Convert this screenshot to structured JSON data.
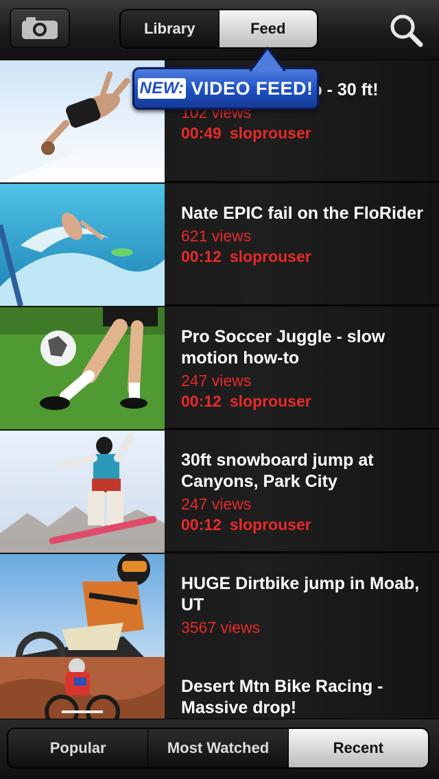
{
  "header": {
    "camera_icon": "camera-icon",
    "segments": [
      {
        "label": "Library",
        "selected": false
      },
      {
        "label": "Feed",
        "selected": true
      }
    ],
    "search_icon": "search-icon"
  },
  "callout": {
    "badge": "NEW:",
    "text": "VIDEO FEED!"
  },
  "feed": {
    "items": [
      {
        "title": "HUGE Bike Jump - 30 ft!",
        "views": "102 views",
        "duration": "00:49",
        "user": "sloprouser"
      },
      {
        "title": "Nate EPIC fail on the FloRider",
        "views": "621 views",
        "duration": "00:12",
        "user": "sloprouser"
      },
      {
        "title": "Pro Soccer Juggle - slow motion how-to",
        "views": "247 views",
        "duration": "00:12",
        "user": "sloprouser"
      },
      {
        "title": "30ft snowboard jump at Canyons, Park City",
        "views": "247 views",
        "duration": "00:12",
        "user": "sloprouser"
      },
      {
        "title": "HUGE Dirtbike jump in Moab, UT",
        "views": "3567 views",
        "duration": "",
        "user": ""
      },
      {
        "title": "Desert Mtn Bike Racing - Massive drop!",
        "views": "",
        "duration": "",
        "user": ""
      }
    ]
  },
  "footer": {
    "tabs": [
      {
        "label": "Popular",
        "selected": false
      },
      {
        "label": "Most Watched",
        "selected": false
      },
      {
        "label": "Recent",
        "selected": true
      }
    ]
  },
  "colors": {
    "accent_red": "#e82a2a",
    "callout_blue": "#1e4fc2"
  }
}
